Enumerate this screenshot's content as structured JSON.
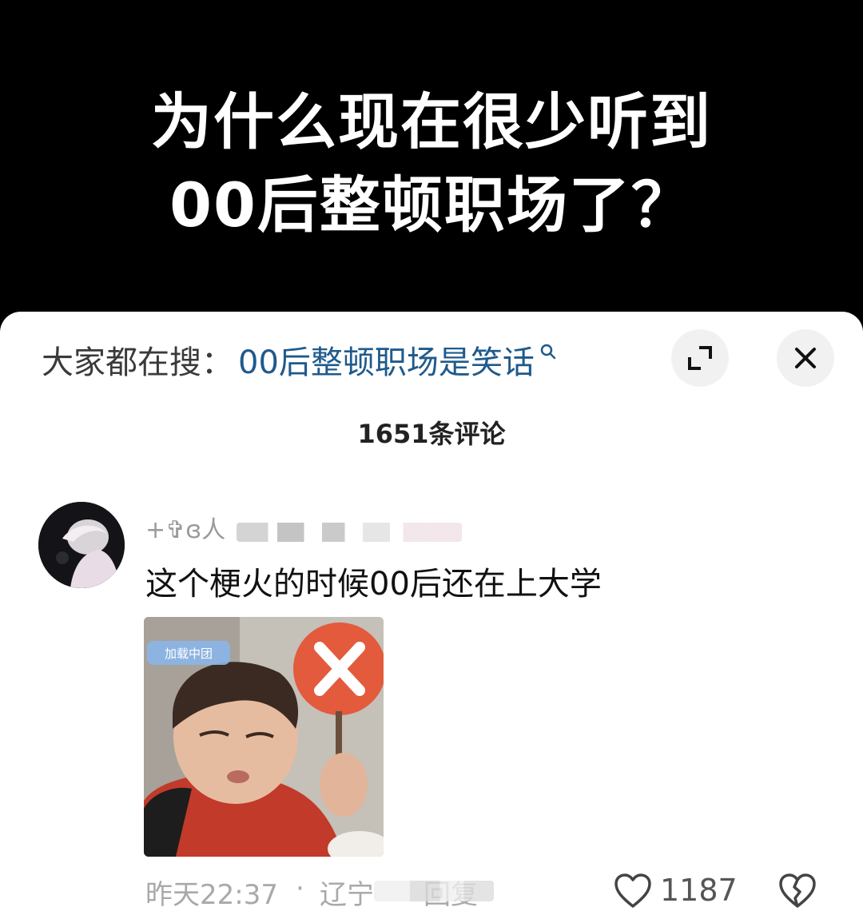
{
  "banner": {
    "line1": "为什么现在很少听到",
    "line2": "00后整顿职场了？"
  },
  "search": {
    "prefix": "大家都在搜：",
    "term": "00后整顿职场是笑话",
    "icon": "search-icon"
  },
  "controls": {
    "expand_icon": "expand-icon",
    "close_icon": "close-icon"
  },
  "comments_header": {
    "count_text": "1651条评论"
  },
  "comment": {
    "username": "+✞ɞ人",
    "text": "这个梗火的时候00后还在上大学",
    "image_caption": "加载中团",
    "time": "昨天22:37",
    "separator": "·",
    "location": "辽宁",
    "reply": "回复",
    "likes": "1187"
  },
  "colors": {
    "banner_bg": "#000000",
    "sheet_bg": "#ffffff",
    "search_term": "#1f5a8c",
    "meta_gray": "#a9a9a9"
  }
}
